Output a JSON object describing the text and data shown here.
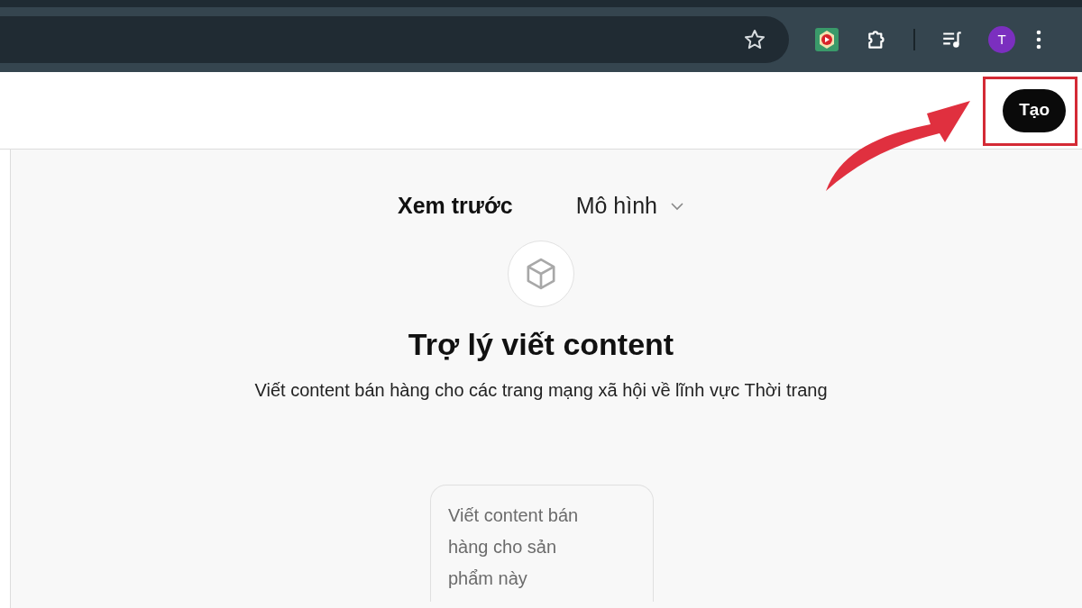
{
  "browser_toolbar": {
    "avatar_letter": "T"
  },
  "header": {
    "create_button": "Tạo"
  },
  "preview": {
    "tabs": [
      {
        "label": "Xem trước",
        "selected": true
      },
      {
        "label": "Mô hình",
        "selected": false
      }
    ],
    "title": "Trợ lý viết content",
    "description": "Viết content bán hàng cho các trang mạng xã hội về lĩnh vực Thời trang",
    "suggestion": "Viết content bán hàng cho sản phẩm này"
  }
}
